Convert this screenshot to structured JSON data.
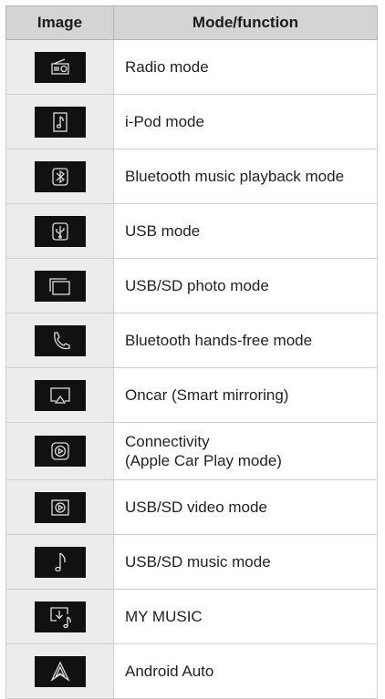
{
  "headers": {
    "image": "Image",
    "mode": "Mode/function"
  },
  "rows": [
    {
      "icon": "radio-icon",
      "label": "Radio mode"
    },
    {
      "icon": "ipod-icon",
      "label": "i-Pod mode"
    },
    {
      "icon": "bluetooth-icon",
      "label": "Bluetooth music playback mode"
    },
    {
      "icon": "usb-icon",
      "label": "USB mode"
    },
    {
      "icon": "photo-icon",
      "label": "USB/SD photo mode"
    },
    {
      "icon": "phone-icon",
      "label": "Bluetooth hands-free mode"
    },
    {
      "icon": "mirroring-icon",
      "label": "Oncar (Smart mirroring)"
    },
    {
      "icon": "carplay-icon",
      "label_line1": "Connectivity",
      "label_line2": "(Apple Car Play mode)"
    },
    {
      "icon": "video-icon",
      "label": "USB/SD video mode"
    },
    {
      "icon": "music-note-icon",
      "label": "USB/SD music mode"
    },
    {
      "icon": "my-music-icon",
      "label": "MY MUSIC"
    },
    {
      "icon": "android-auto-icon",
      "label": "Android Auto"
    }
  ]
}
